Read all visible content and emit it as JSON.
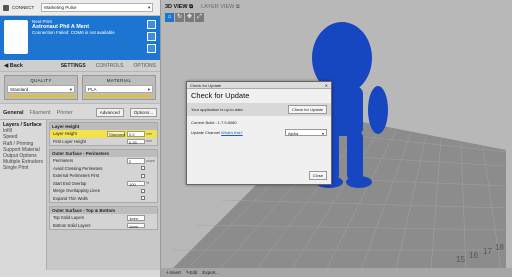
{
  "header": {
    "connect_label": "CONNECT",
    "printer_select": "Marketing Pulse"
  },
  "printer": {
    "name_line": "Next Print",
    "model_name": "Astronaut Phil A Ment",
    "status": "Connection Failed: COM6 is not available"
  },
  "nav": {
    "back_label": "Back",
    "tabs": [
      "SETTINGS",
      "CONTROLS",
      "OPTIONS"
    ]
  },
  "quality": {
    "title": "QUALITY",
    "value": "Standard"
  },
  "material": {
    "title": "MATERIAL",
    "value": "PLA"
  },
  "section_tabs": {
    "tabs": [
      "General",
      "Filament",
      "Printer"
    ],
    "advanced_label": "Advanced",
    "options_label": "Options..."
  },
  "categories": [
    "Layers / Surface",
    "Infill",
    "Speed",
    "Raft / Priming",
    "Support Material",
    "Output Options",
    "Multiple Extruders",
    "Single Print"
  ],
  "groups": {
    "layer_height": {
      "title": "Layer Height",
      "layer_height_label": "Layer Height",
      "layer_height_preset": "Standard",
      "layer_height_value": "0.2",
      "layer_height_unit": "mm",
      "first_layer_label": "First Layer Height",
      "first_layer_value": "0.25",
      "first_layer_unit": "mm"
    },
    "outer_perimeters": {
      "title": "Outer Surface - Perimeters",
      "perimeters_label": "Perimeters",
      "perimeters_value": "2",
      "perimeters_unit": "count",
      "avoid_crossing_label": "Avoid Crossing Perimeters",
      "external_first_label": "External Perimeters First",
      "start_end_overlap_label": "Start End Overlap",
      "start_end_overlap_value": "100",
      "start_end_overlap_unit": "%",
      "merge_overlap_label": "Merge Overlapping Lines",
      "expand_thin_label": "Expand Thin Walls"
    },
    "top_bottom": {
      "title": "Outer Surface - Top & Bottom",
      "top_solid_label": "Top Solid Layers",
      "top_solid_value": "1mm",
      "bottom_solid_label": "Bottom Solid Layers",
      "bottom_solid_value": "1mm"
    }
  },
  "viewport": {
    "tab_3d": "3D VIEW",
    "tab_layer": "LAYER VIEW",
    "bottom_items": [
      "Insert",
      "Edit",
      "Export..."
    ]
  },
  "dialog": {
    "window_title": "Check for Update",
    "heading": "Check for Update",
    "status_text": "Your application is up-to-date.",
    "check_button": "Check for Update",
    "current_build": "Current Build : 1.7.5.8080",
    "channel_label": "Update Channel",
    "channel_link": "What's this?",
    "channel_value": "Alpha",
    "close_label": "Close"
  },
  "colors": {
    "accent": "#1c76d1",
    "highlight": "#f3e24a",
    "model": "#1646c0"
  }
}
